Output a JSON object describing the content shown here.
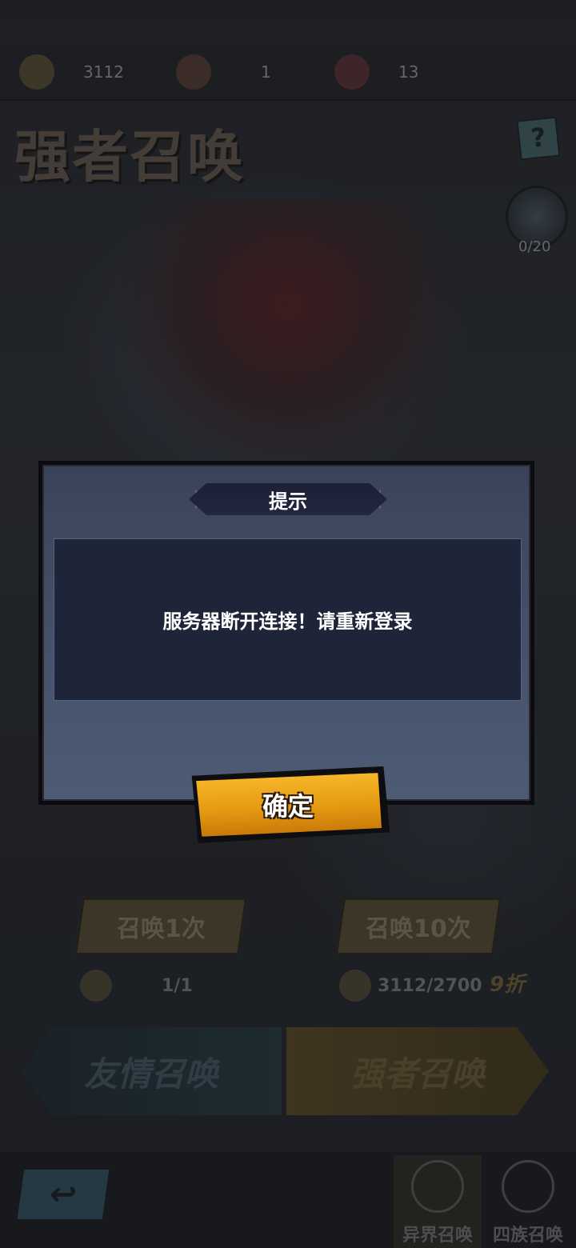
{
  "resources": [
    {
      "icon": "gold-coin-icon",
      "value": "3112"
    },
    {
      "icon": "summon-scroll-icon",
      "value": "1"
    },
    {
      "icon": "heart-icon",
      "value": "13"
    }
  ],
  "page_title": "强者召唤",
  "help_label": "?",
  "pity_counter": "0/20",
  "summon_buttons": {
    "single": "召唤1次",
    "ten": "召唤10次"
  },
  "costs": {
    "single": "1/1",
    "ten": "3112/2700",
    "discount": "9折"
  },
  "tabs": {
    "friendship": "友情召唤",
    "strong": "强者召唤"
  },
  "back_icon": "back-arrow-icon",
  "modes": [
    {
      "icon": "hexagram-icon",
      "label": "异界召唤"
    },
    {
      "icon": "magic-circle-icon",
      "label": "四族召唤"
    }
  ],
  "dialog": {
    "title": "提示",
    "message": "服务器断开连接！请重新登录",
    "confirm_label": "确定"
  },
  "colors": {
    "dialog_bg": "#46526b",
    "message_bg": "#1f2538",
    "confirm_button": "#e59a12"
  }
}
